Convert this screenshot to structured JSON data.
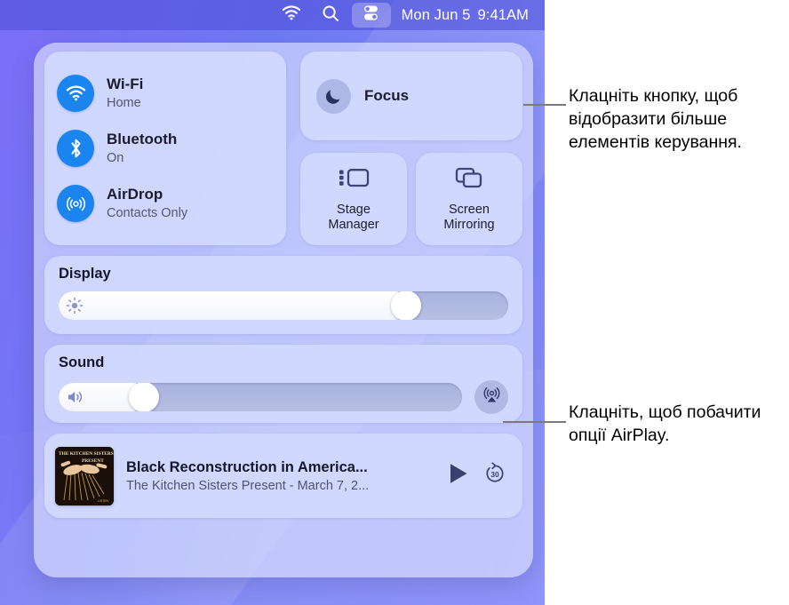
{
  "menubar": {
    "wifi_icon": "wifi-icon",
    "search_icon": "search-icon",
    "control_center_icon": "control-center-icon",
    "day": "Mon Jun 5",
    "time": "9:41AM"
  },
  "control_center": {
    "connectivity": [
      {
        "icon": "wifi-icon",
        "title": "Wi-Fi",
        "status": "Home"
      },
      {
        "icon": "bluetooth-icon",
        "title": "Bluetooth",
        "status": "On"
      },
      {
        "icon": "airdrop-icon",
        "title": "AirDrop",
        "status": "Contacts Only"
      }
    ],
    "focus": {
      "icon": "moon-icon",
      "label": "Focus"
    },
    "stage_manager": {
      "icon": "stage-manager-icon",
      "label": "Stage\nManager",
      "line1": "Stage",
      "line2": "Manager"
    },
    "screen_mirroring": {
      "icon": "screen-mirroring-icon",
      "label": "Screen\nMirroring",
      "line1": "Screen",
      "line2": "Mirroring"
    },
    "display": {
      "label": "Display",
      "icon": "brightness-icon",
      "value": 78
    },
    "sound": {
      "label": "Sound",
      "icon": "volume-icon",
      "value": 22,
      "airplay_icon": "airplay-icon"
    },
    "media": {
      "artwork_alt": "The Kitchen Sisters Present",
      "artwork_line1": "THE KITCHEN SISTERS",
      "artwork_line2": "PRESENT",
      "title": "Black Reconstruction in America...",
      "subtitle": "The Kitchen Sisters Present - March 7, 2...",
      "play_icon": "play-icon",
      "skip_icon": "skip-forward-30-icon",
      "skip_label": "30"
    }
  },
  "callouts": [
    {
      "id": "callout-controls",
      "text": "Клацніть кнопку, щоб відобразити більше елементів керування."
    },
    {
      "id": "callout-airplay",
      "text": "Клацніть, щоб побачити опції AirPlay."
    }
  ],
  "colors": {
    "accent_blue": "#1a84ef",
    "panel": "#d2d9ff",
    "desktop_purple": "#7b6ef6",
    "text_dark": "#15172a",
    "leader_gray": "#7a7a7a"
  }
}
